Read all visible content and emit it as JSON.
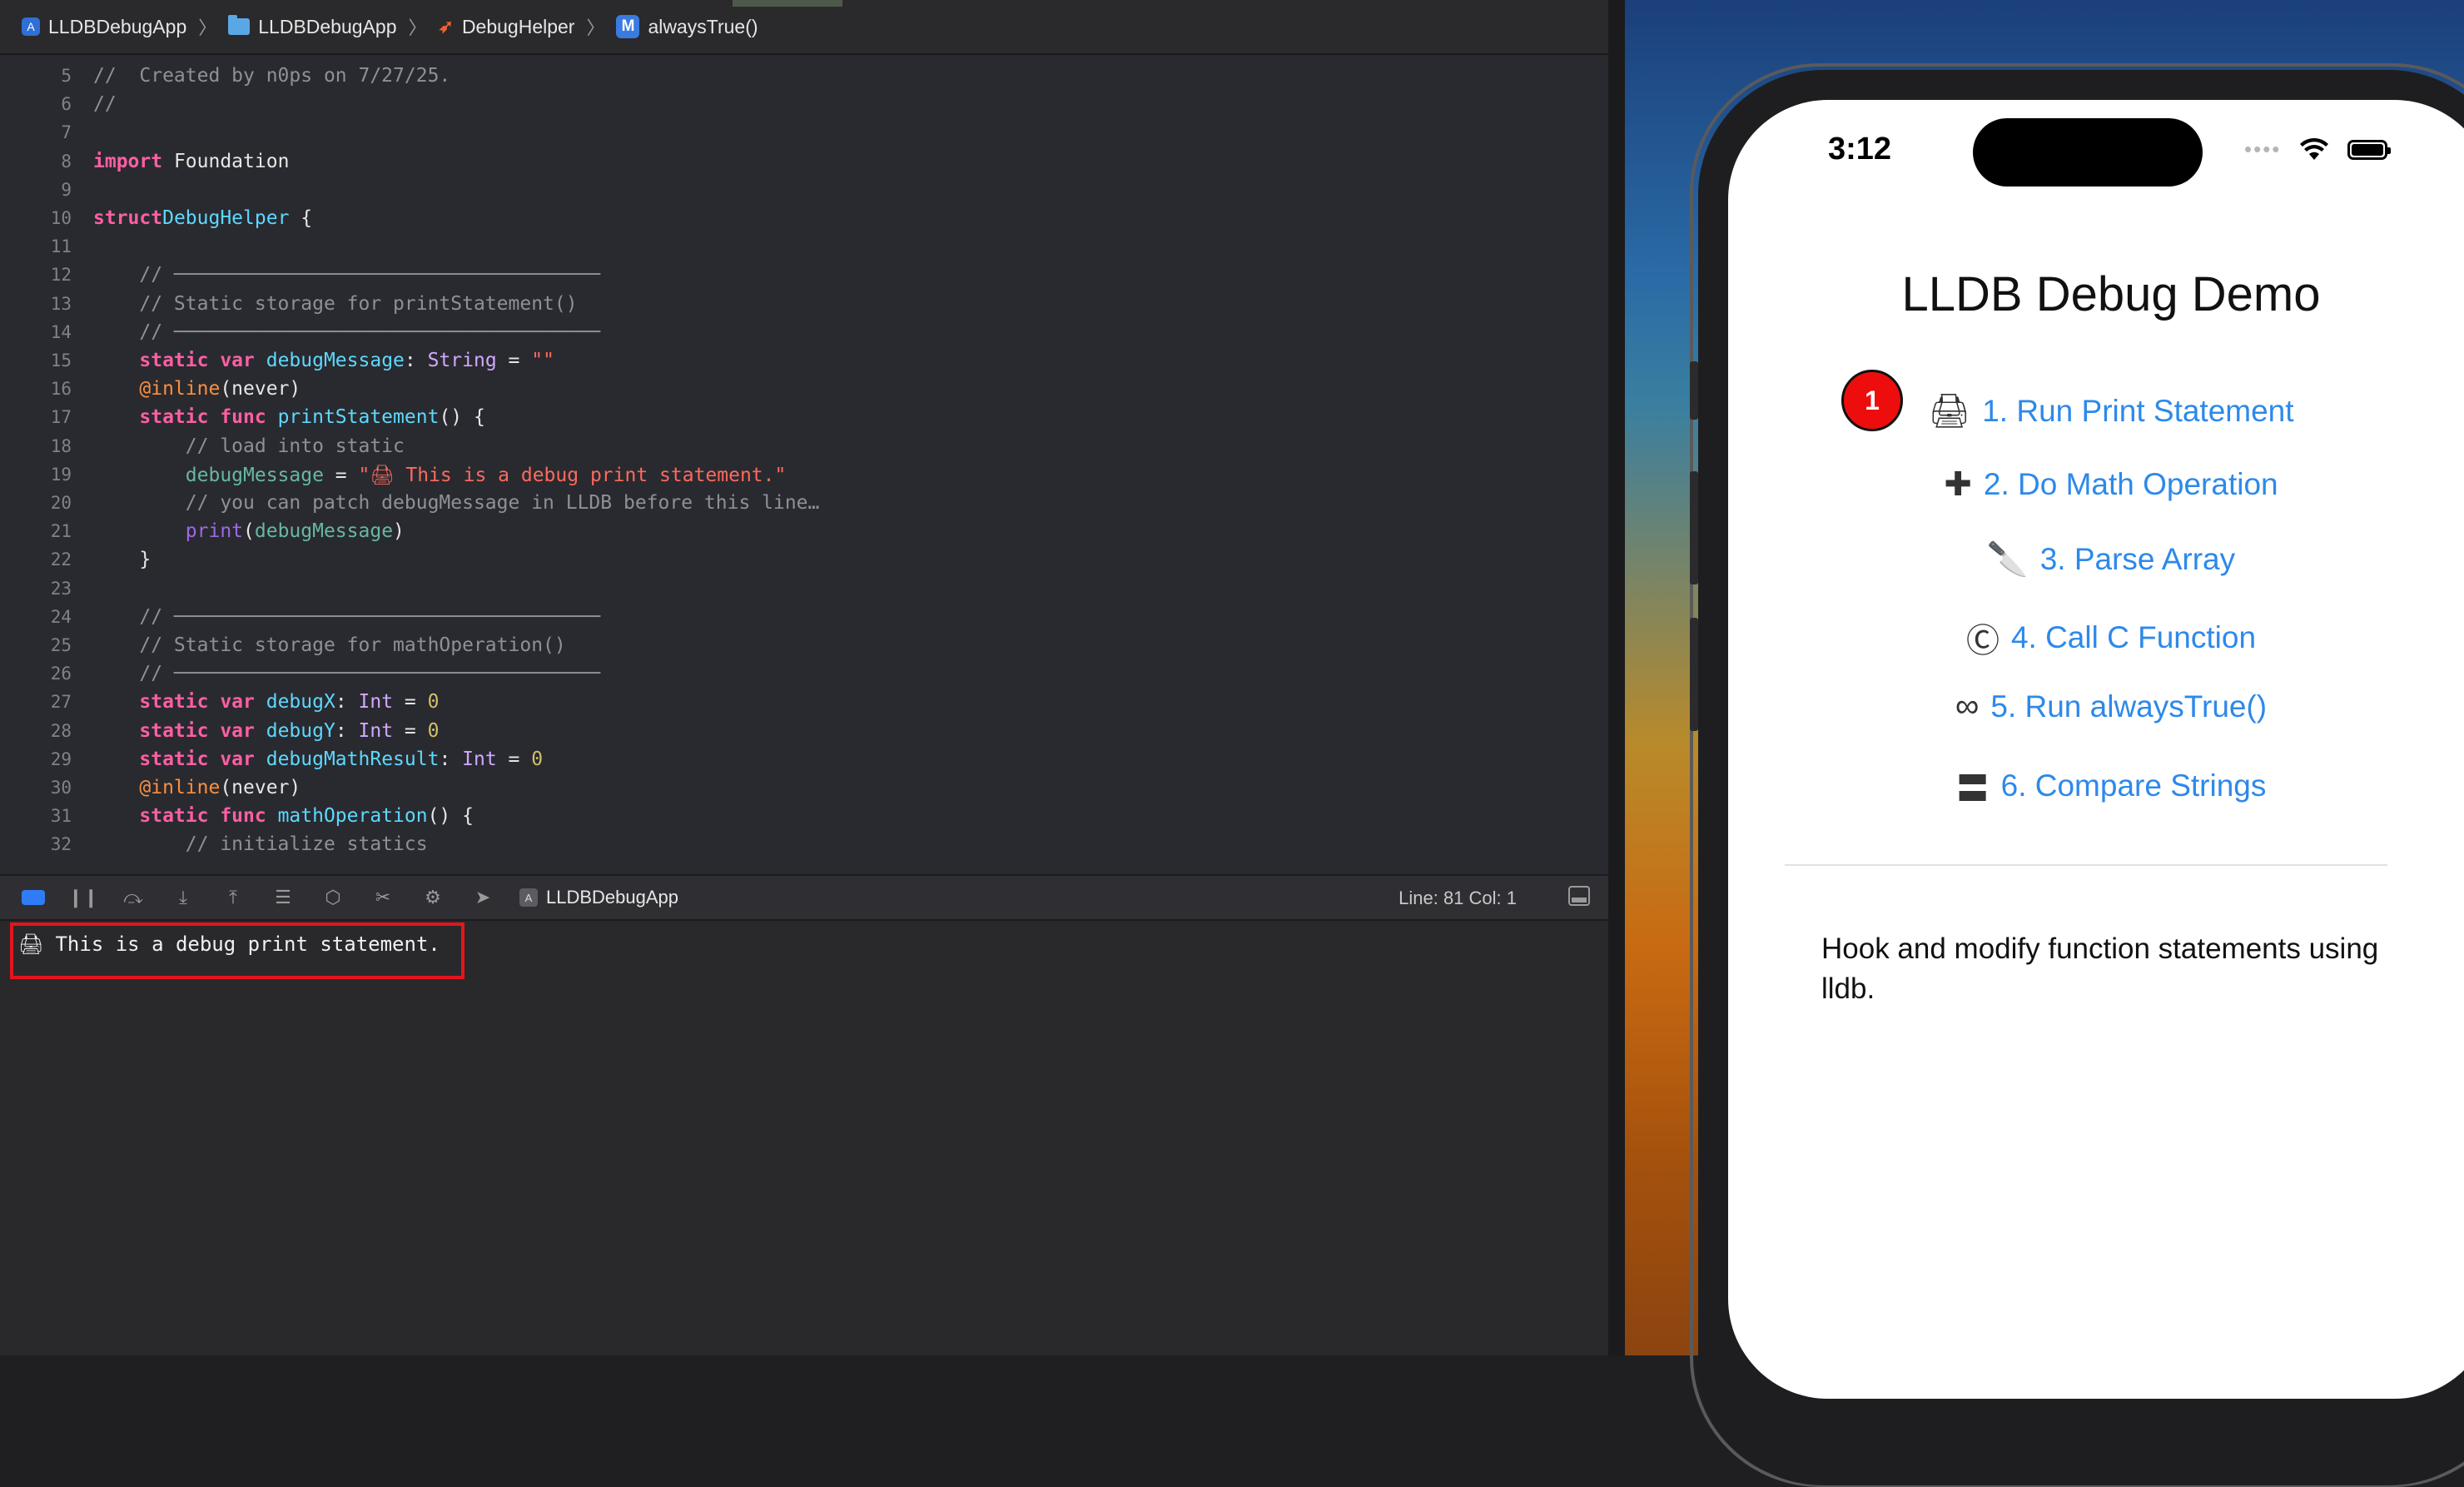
{
  "breadcrumb": {
    "items": [
      "LLDBDebugApp",
      "LLDBDebugApp",
      "DebugHelper",
      "alwaysTrue()"
    ],
    "m_glyph": "M"
  },
  "editor": {
    "lines": [
      {
        "n": "5",
        "text": "//  Created by n0ps on 7/27/25."
      },
      {
        "n": "6",
        "text": "//"
      },
      {
        "n": "7",
        "text": ""
      },
      {
        "n": "8",
        "kw": "import",
        "rest": " Foundation"
      },
      {
        "n": "9",
        "text": ""
      },
      {
        "n": "10",
        "kw": "struct",
        "name": "DebugHelper",
        "rest": " {"
      },
      {
        "n": "11",
        "text": ""
      },
      {
        "n": "12",
        "text": "    // ─────────────────────────────────────"
      },
      {
        "n": "13",
        "text": "    // Static storage for printStatement()"
      },
      {
        "n": "14",
        "text": "    // ─────────────────────────────────────"
      },
      {
        "n": "15",
        "kw": "    static var ",
        "name": "debugMessage",
        "mid": ": ",
        "type": "String",
        "eq": " = ",
        "str": "\"\""
      },
      {
        "n": "16",
        "attr": "    @inline",
        "rest": "(never)"
      },
      {
        "n": "17",
        "kw": "    static func ",
        "name": "printStatement",
        "rest": "() {"
      },
      {
        "n": "18",
        "text": "        // load into static"
      },
      {
        "n": "19",
        "id": "        debugMessage",
        "eq": " = ",
        "str": "\"🖨 This is a debug print statement.\""
      },
      {
        "n": "20",
        "text": "        // you can patch debugMessage in LLDB before this line…"
      },
      {
        "n": "21",
        "fn": "        print",
        "rest": "(",
        "id": "debugMessage",
        "rest2": ")"
      },
      {
        "n": "22",
        "text": "    }"
      },
      {
        "n": "23",
        "text": ""
      },
      {
        "n": "24",
        "text": "    // ─────────────────────────────────────"
      },
      {
        "n": "25",
        "text": "    // Static storage for mathOperation()"
      },
      {
        "n": "26",
        "text": "    // ─────────────────────────────────────"
      },
      {
        "n": "27",
        "kw": "    static var ",
        "name": "debugX",
        "mid": ": ",
        "type": "Int",
        "eq": " = ",
        "num": "0"
      },
      {
        "n": "28",
        "kw": "    static var ",
        "name": "debugY",
        "mid": ": ",
        "type": "Int",
        "eq": " = ",
        "num": "0"
      },
      {
        "n": "29",
        "kw": "    static var ",
        "name": "debugMathResult",
        "mid": ": ",
        "type": "Int",
        "eq": " = ",
        "num": "0"
      },
      {
        "n": "30",
        "attr": "    @inline",
        "rest": "(never)"
      },
      {
        "n": "31",
        "kw": "    static func ",
        "name": "mathOperation",
        "rest": "() {"
      },
      {
        "n": "32",
        "text": "        // initialize statics"
      }
    ]
  },
  "debugbar": {
    "target": "LLDBDebugApp",
    "linecol": "Line: 81  Col: 1"
  },
  "console": {
    "output": "This is a debug print statement."
  },
  "sim": {
    "time": "3:12",
    "title": "LLDB Debug Demo",
    "badge": "1",
    "menu": [
      {
        "icon": "🖨",
        "label": "1. Run Print Statement"
      },
      {
        "icon": "✚",
        "label": "2. Do Math Operation"
      },
      {
        "icon": "🔪",
        "label": "3. Parse Array"
      },
      {
        "icon": "Ⓒ",
        "label": "4. Call C Function"
      },
      {
        "icon": "∞",
        "label": "5. Run alwaysTrue()"
      },
      {
        "icon": "〓",
        "label": "6. Compare Strings"
      }
    ],
    "description": "Hook and modify function statements using lldb."
  },
  "colors": {
    "keyword": "#fc5fa3",
    "type": "#5dd8ff",
    "string": "#fc6a5d",
    "link": "#2d89ea",
    "highlight": "#e5141c"
  }
}
